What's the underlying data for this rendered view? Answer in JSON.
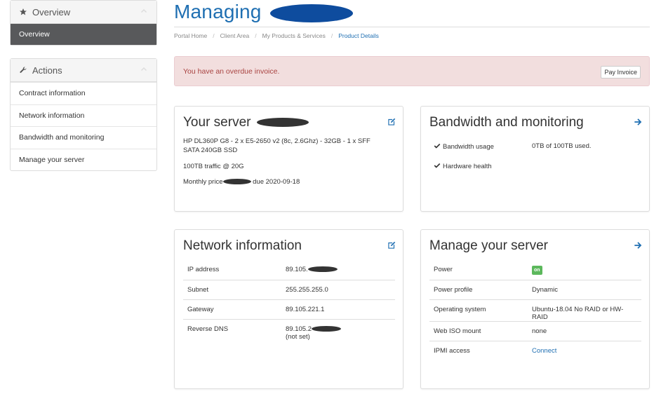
{
  "sidebar": {
    "overview": {
      "title": "Overview",
      "active_item": "Overview"
    },
    "actions": {
      "title": "Actions",
      "items": [
        {
          "label": "Contract information"
        },
        {
          "label": "Network information"
        },
        {
          "label": "Bandwidth and monitoring"
        },
        {
          "label": "Manage your server"
        }
      ]
    }
  },
  "page": {
    "title": "Managing"
  },
  "breadcrumb": [
    {
      "label": "Portal Home"
    },
    {
      "label": "Client Area"
    },
    {
      "label": "My Products & Services"
    },
    {
      "label": "Product Details"
    }
  ],
  "alert": {
    "text": "You have an overdue invoice.",
    "button": "Pay Invoice"
  },
  "server": {
    "title": "Your server",
    "spec": "HP DL360P G8 - 2 x E5-2650 v2 (8c, 2.6Ghz) - 32GB - 1 x SFF SATA 240GB SSD",
    "traffic": "100TB traffic @ 20G",
    "price_prefix": "Monthly price",
    "price_suffix": "due 2020-09-18"
  },
  "bandwidth": {
    "title": "Bandwidth and monitoring",
    "rows": [
      {
        "label": "Bandwidth usage",
        "value": "0TB of 100TB used."
      },
      {
        "label": "Hardware health",
        "value": ""
      }
    ]
  },
  "network": {
    "title": "Network information",
    "rows": [
      {
        "label": "IP address",
        "value": "89.105."
      },
      {
        "label": "Subnet",
        "value": "255.255.255.0"
      },
      {
        "label": "Gateway",
        "value": "89.105.221.1"
      },
      {
        "label": "Reverse DNS",
        "value": "89.105.2",
        "value2": "(not set)"
      }
    ]
  },
  "manage": {
    "title": "Manage your server",
    "rows": [
      {
        "label": "Power",
        "value": "on"
      },
      {
        "label": "Power profile",
        "value": "Dynamic"
      },
      {
        "label": "Operating system",
        "value": "Ubuntu-18.04 No RAID or HW-RAID"
      },
      {
        "label": "Web ISO mount",
        "value": "none"
      },
      {
        "label": "IPMI access",
        "value": "Connect"
      }
    ]
  },
  "colors": {
    "accent": "#1f6fb2",
    "sidebar_active": "#58595b",
    "alert_bg": "#f2dede",
    "alert_text": "#a94442",
    "power_on": "#5cb85c"
  },
  "icons": {
    "overview": "star-icon",
    "actions": "wrench-icon",
    "collapse": "chevron-up-icon",
    "edit": "edit-icon",
    "go": "arrow-right-icon",
    "check": "check-icon"
  }
}
